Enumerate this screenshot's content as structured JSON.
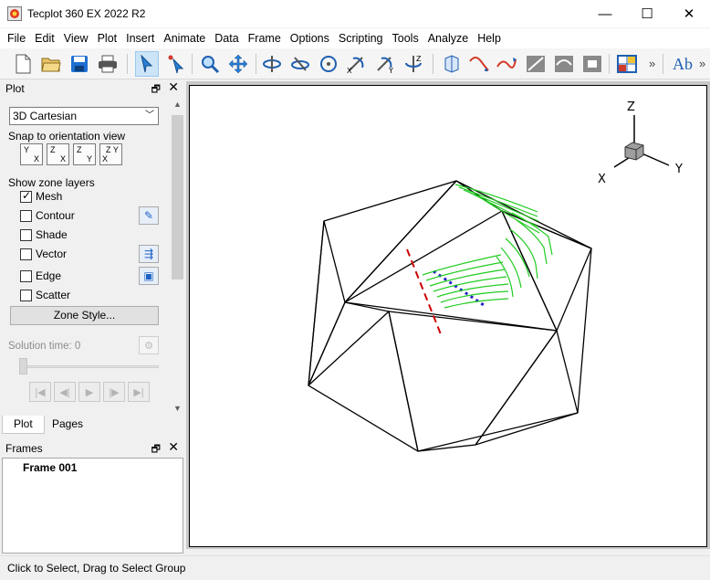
{
  "window": {
    "title": "Tecplot 360 EX 2022 R2",
    "controls": {
      "minimize": "—",
      "maximize": "☐",
      "close": "✕"
    }
  },
  "menu": [
    "File",
    "Edit",
    "View",
    "Plot",
    "Insert",
    "Animate",
    "Data",
    "Frame",
    "Options",
    "Scripting",
    "Tools",
    "Analyze",
    "Help"
  ],
  "toolbar": {
    "icons": [
      "new-layout-icon",
      "open-icon",
      "save-icon",
      "print-icon",
      "select-arrow-icon",
      "adjustor-icon",
      "zoom-icon",
      "translate-icon",
      "rotate-x-icon",
      "rotate-y-icon",
      "spherical-rotate-icon",
      "rotate-about-x-icon",
      "rotate-about-y-icon",
      "rotate-about-z-icon",
      "probe-icon",
      "streamtrace-icon",
      "streamline-icon",
      "slice-icon",
      "isosurface-icon",
      "zone-icon",
      "frame-icon",
      "text-icon"
    ],
    "more": "»",
    "text_tool": "Ab"
  },
  "plot_panel": {
    "title": "Plot",
    "plot_type": "3D Cartesian",
    "snap_label": "Snap to orientation view",
    "snap_views": [
      {
        "top": "Y",
        "bottom": "X"
      },
      {
        "top": "Z",
        "bottom": "X"
      },
      {
        "top": "Z",
        "bottom": "Y"
      },
      {
        "top": "Z Y",
        "bottom": "X"
      }
    ],
    "zone_layers_label": "Show zone layers",
    "layers": [
      {
        "label": "Mesh",
        "checked": true
      },
      {
        "label": "Contour",
        "checked": false
      },
      {
        "label": "Shade",
        "checked": false
      },
      {
        "label": "Vector",
        "checked": false
      },
      {
        "label": "Edge",
        "checked": false
      },
      {
        "label": "Scatter",
        "checked": false
      }
    ],
    "zone_style_button": "Zone Style...",
    "solution_time_label": "Solution time:",
    "solution_time_value": "0",
    "tabs": [
      "Plot",
      "Pages"
    ]
  },
  "frames_panel": {
    "title": "Frames",
    "items": [
      "Frame 001"
    ]
  },
  "axes_triad": {
    "z": "Z",
    "x": "X",
    "y": "Y"
  },
  "colors": {
    "streamtrace": "#22cc22",
    "slice_line_red": "#cc0000",
    "slice_line_blue": "#2222cc",
    "selected_tool": "#cce4f7"
  },
  "status": "Click to Select, Drag to Select Group"
}
